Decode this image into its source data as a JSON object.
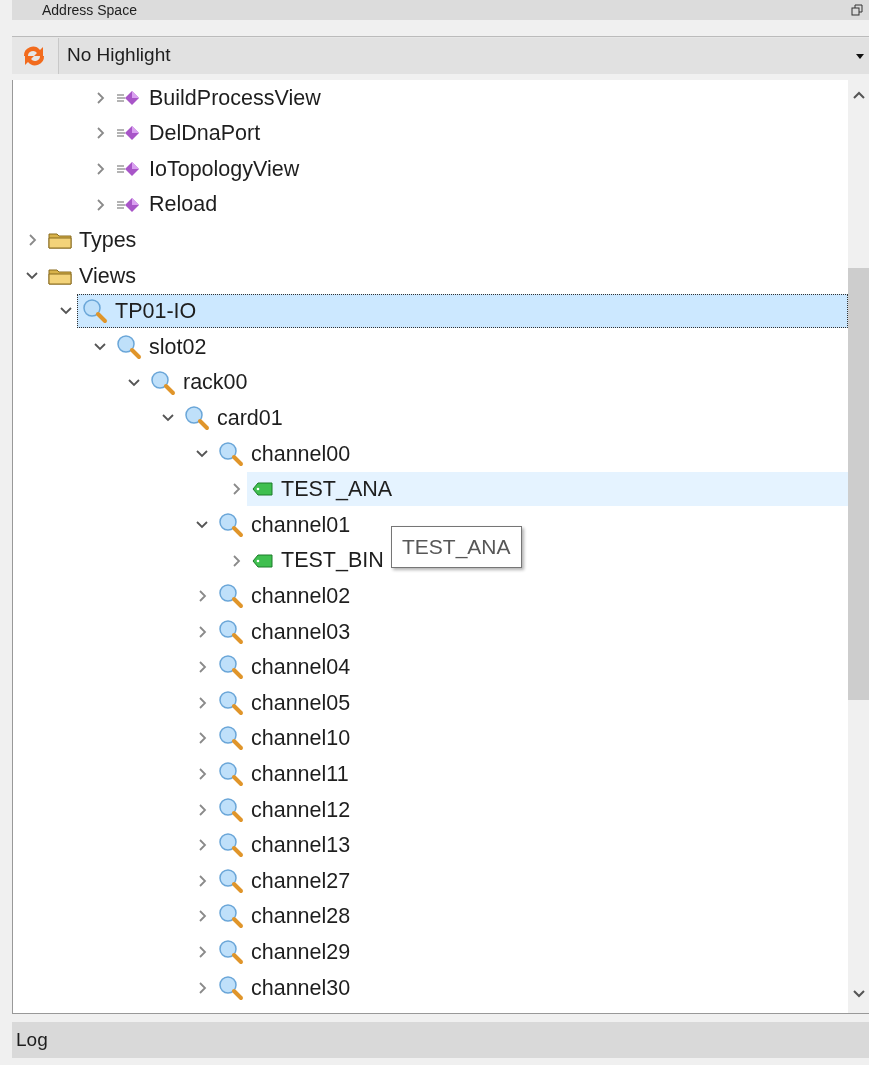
{
  "panel": {
    "title": "Address Space"
  },
  "toolbar": {
    "highlight_select": "No Highlight"
  },
  "tree": {
    "scrolled_branch": [
      {
        "label": "BuildProcessView",
        "kind": "method",
        "expanded": false,
        "selected": false,
        "hovered": false
      },
      {
        "label": "DelDnaPort",
        "kind": "method",
        "expanded": false,
        "selected": false,
        "hovered": false
      },
      {
        "label": "IoTopologyView",
        "kind": "method",
        "expanded": false,
        "selected": false,
        "hovered": false
      },
      {
        "label": "Reload",
        "kind": "method",
        "expanded": false,
        "selected": false,
        "hovered": false
      }
    ],
    "nodes": [
      {
        "label": "Types",
        "kind": "folder",
        "expanded": false,
        "selected": false,
        "hovered": false
      },
      {
        "label": "Views",
        "kind": "folder",
        "expanded": true,
        "selected": false,
        "hovered": false,
        "children": [
          {
            "label": "TP01-IO",
            "kind": "view",
            "expanded": true,
            "selected": true,
            "hovered": false,
            "children": [
              {
                "label": "slot02",
                "kind": "view",
                "expanded": true,
                "selected": false,
                "hovered": false,
                "children": [
                  {
                    "label": "rack00",
                    "kind": "view",
                    "expanded": true,
                    "selected": false,
                    "hovered": false,
                    "children": [
                      {
                        "label": "card01",
                        "kind": "view",
                        "expanded": true,
                        "selected": false,
                        "hovered": false,
                        "children": [
                          {
                            "label": "channel00",
                            "kind": "view",
                            "expanded": true,
                            "selected": false,
                            "hovered": false,
                            "children": [
                              {
                                "label": "TEST_ANA",
                                "kind": "tag",
                                "expanded": false,
                                "selected": false,
                                "hovered": true
                              }
                            ]
                          },
                          {
                            "label": "channel01",
                            "kind": "view",
                            "expanded": true,
                            "selected": false,
                            "hovered": false,
                            "children": [
                              {
                                "label": "TEST_BIN",
                                "kind": "tag",
                                "expanded": false,
                                "selected": false,
                                "hovered": false
                              }
                            ]
                          },
                          {
                            "label": "channel02",
                            "kind": "view",
                            "expanded": false,
                            "selected": false,
                            "hovered": false
                          },
                          {
                            "label": "channel03",
                            "kind": "view",
                            "expanded": false,
                            "selected": false,
                            "hovered": false
                          },
                          {
                            "label": "channel04",
                            "kind": "view",
                            "expanded": false,
                            "selected": false,
                            "hovered": false
                          },
                          {
                            "label": "channel05",
                            "kind": "view",
                            "expanded": false,
                            "selected": false,
                            "hovered": false
                          },
                          {
                            "label": "channel10",
                            "kind": "view",
                            "expanded": false,
                            "selected": false,
                            "hovered": false
                          },
                          {
                            "label": "channel11",
                            "kind": "view",
                            "expanded": false,
                            "selected": false,
                            "hovered": false
                          },
                          {
                            "label": "channel12",
                            "kind": "view",
                            "expanded": false,
                            "selected": false,
                            "hovered": false
                          },
                          {
                            "label": "channel13",
                            "kind": "view",
                            "expanded": false,
                            "selected": false,
                            "hovered": false
                          },
                          {
                            "label": "channel27",
                            "kind": "view",
                            "expanded": false,
                            "selected": false,
                            "hovered": false
                          },
                          {
                            "label": "channel28",
                            "kind": "view",
                            "expanded": false,
                            "selected": false,
                            "hovered": false
                          },
                          {
                            "label": "channel29",
                            "kind": "view",
                            "expanded": false,
                            "selected": false,
                            "hovered": false
                          },
                          {
                            "label": "channel30",
                            "kind": "view",
                            "expanded": false,
                            "selected": false,
                            "hovered": false
                          }
                        ]
                      }
                    ]
                  }
                ]
              }
            ]
          }
        ]
      }
    ],
    "tooltip": {
      "text": "TEST_ANA"
    }
  },
  "log_bar": {
    "title": "Log"
  }
}
